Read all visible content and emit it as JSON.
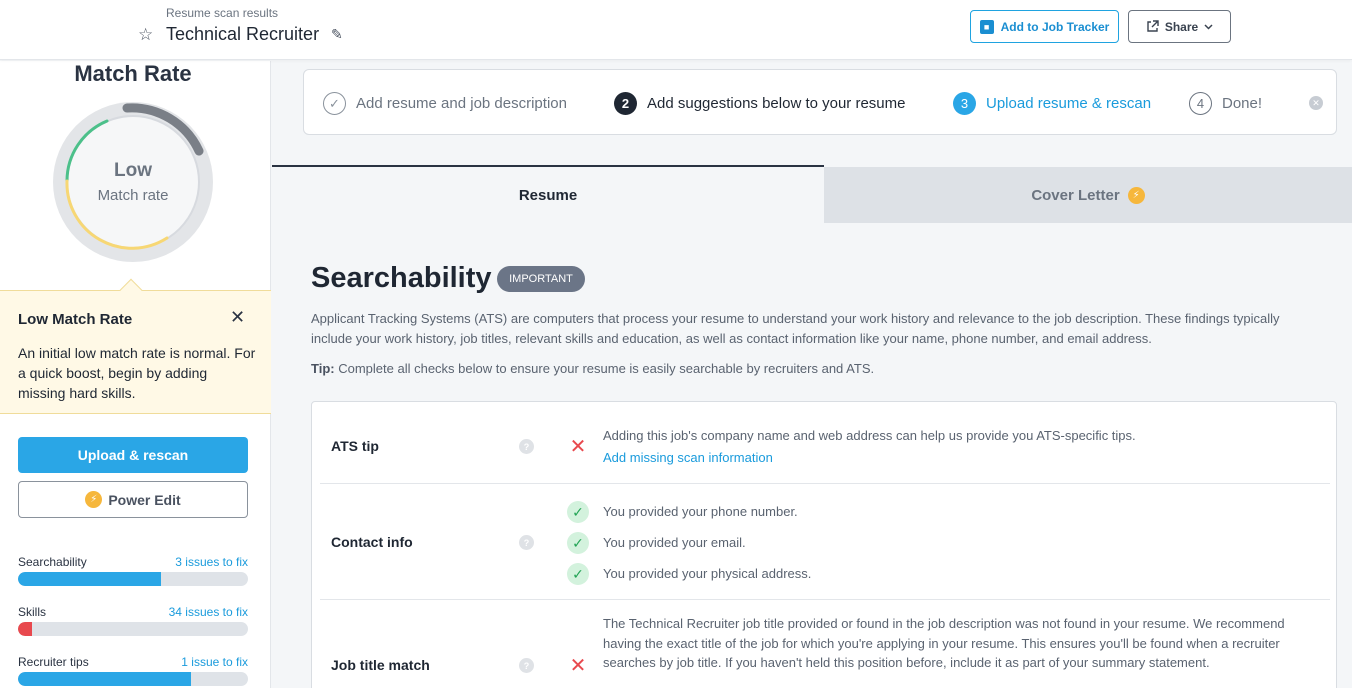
{
  "header": {
    "breadcrumb": "Resume scan results",
    "title": "Technical Recruiter",
    "add_tracker_label": "Add to Job Tracker",
    "share_label": "Share"
  },
  "sidebar": {
    "match_title": "Match Rate",
    "gauge_level": "Low",
    "gauge_sublabel": "Match rate",
    "tip": {
      "heading": "Low Match Rate",
      "body": "An initial low match rate is normal. For a quick boost, begin by adding missing hard skills."
    },
    "upload_label": "Upload & rescan",
    "power_edit_label": "Power Edit",
    "metrics": [
      {
        "label": "Searchability",
        "link": "3 issues to fix",
        "progress": 0.62,
        "color": "#2aa6e6"
      },
      {
        "label": "Skills",
        "link": "34 issues to fix",
        "progress": 0.06,
        "color": "#e8494e"
      },
      {
        "label": "Recruiter tips",
        "link": "1 issue to fix",
        "progress": 0.75,
        "color": "#2aa6e6"
      }
    ]
  },
  "steps": [
    {
      "marker": "✓",
      "label": "Add resume and job description",
      "state": "done"
    },
    {
      "marker": "2",
      "label": "Add suggestions below to your resume",
      "state": "active"
    },
    {
      "marker": "3",
      "label": "Upload resume & rescan",
      "state": "next"
    },
    {
      "marker": "4",
      "label": "Done!",
      "state": "pending"
    }
  ],
  "tabs": {
    "resume": "Resume",
    "cover_letter": "Cover Letter"
  },
  "section": {
    "title": "Searchability",
    "badge": "IMPORTANT",
    "description": "Applicant Tracking Systems (ATS) are computers that process your resume to understand your work history and relevance to the job description. These findings typically include your work history, job titles, relevant skills and education, as well as contact information like your name, phone number, and email address.",
    "tip_label": "Tip:",
    "tip_text": "Complete all checks below to ensure your resume is easily searchable by recruiters and ATS."
  },
  "checks": {
    "ats": {
      "label": "ATS tip",
      "text": "Adding this job's company name and web address can help us provide you ATS-specific tips.",
      "link": "Add missing scan information"
    },
    "contact": {
      "label": "Contact info",
      "items": [
        "You provided your phone number.",
        "You provided your email.",
        "You provided your physical address."
      ]
    },
    "job_title": {
      "label": "Job title match",
      "text": "The Technical Recruiter job title provided or found in the job description was not found in your resume. We recommend having the exact title of the job for which you're applying in your resume. This ensures you'll be found when a recruiter searches by job title. If you haven't held this position before, include it as part of your summary statement."
    }
  },
  "icons": {
    "star": "star-icon",
    "edit": "pencil-icon",
    "tracker": "bookmark-icon",
    "share": "share-icon",
    "help": "question-icon",
    "fail": "x-icon",
    "pass": "check-icon",
    "bolt": "lightning-icon"
  },
  "colors": {
    "accent": "#2aa6e6",
    "danger": "#e8494e",
    "success": "#23a455",
    "gauge_green": "#4cc08a",
    "gauge_yellow": "#f7d774",
    "gauge_gray": "#7a7f87"
  }
}
